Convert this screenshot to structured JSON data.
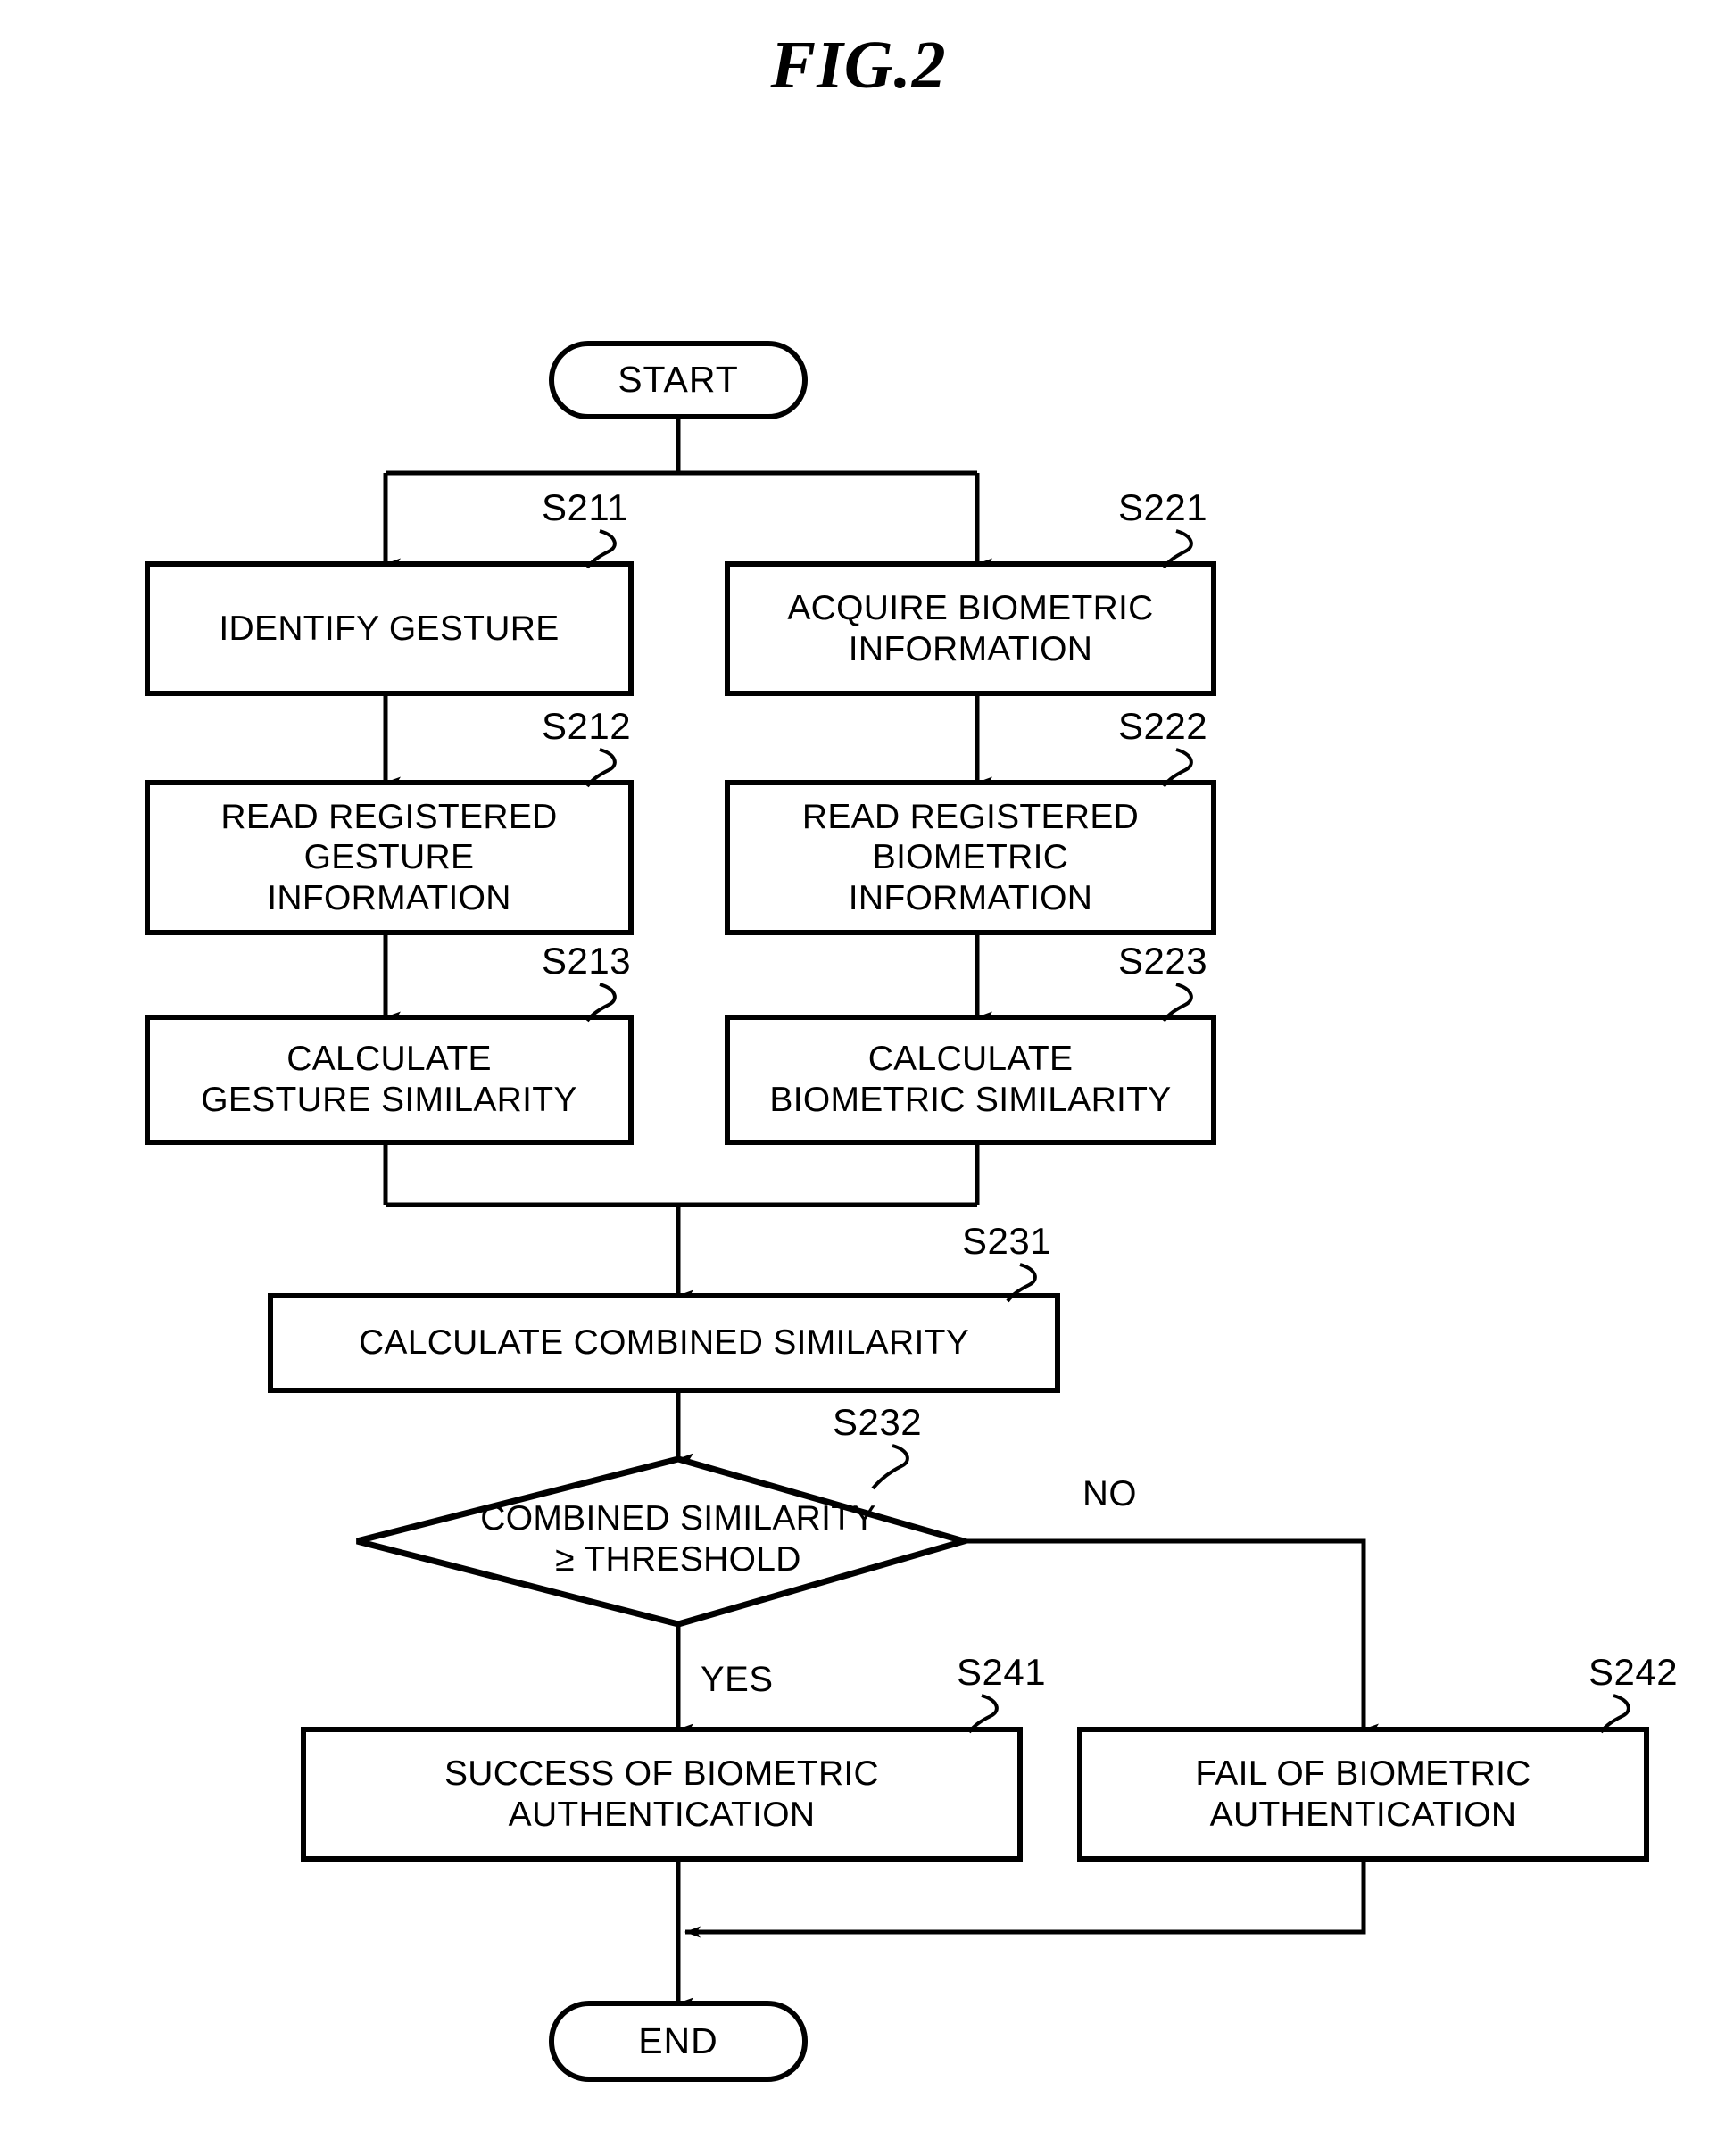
{
  "figure": {
    "title": "FIG.2"
  },
  "nodes": {
    "start": {
      "label": "START",
      "shape": "terminator"
    },
    "end": {
      "label": "END",
      "shape": "terminator"
    },
    "s211": {
      "ref": "S211",
      "label": "IDENTIFY GESTURE",
      "shape": "process"
    },
    "s212": {
      "ref": "S212",
      "label": "READ REGISTERED\nGESTURE\nINFORMATION",
      "shape": "process"
    },
    "s213": {
      "ref": "S213",
      "label": "CALCULATE\nGESTURE SIMILARITY",
      "shape": "process"
    },
    "s221": {
      "ref": "S221",
      "label": "ACQUIRE BIOMETRIC\nINFORMATION",
      "shape": "process"
    },
    "s222": {
      "ref": "S222",
      "label": "READ REGISTERED\nBIOMETRIC\nINFORMATION",
      "shape": "process"
    },
    "s223": {
      "ref": "S223",
      "label": "CALCULATE\nBIOMETRIC SIMILARITY",
      "shape": "process"
    },
    "s231": {
      "ref": "S231",
      "label": "CALCULATE COMBINED SIMILARITY",
      "shape": "process"
    },
    "s232": {
      "ref": "S232",
      "label": "COMBINED SIMILARITY\n≥ THRESHOLD",
      "shape": "decision"
    },
    "s241": {
      "ref": "S241",
      "label": "SUCCESS OF BIOMETRIC\nAUTHENTICATION",
      "shape": "process"
    },
    "s242": {
      "ref": "S242",
      "label": "FAIL OF BIOMETRIC\nAUTHENTICATION",
      "shape": "process"
    }
  },
  "edge_labels": {
    "yes": "YES",
    "no": "NO"
  },
  "style": {
    "stroke": "#000000",
    "fill": "#ffffff",
    "background": "#ffffff"
  }
}
